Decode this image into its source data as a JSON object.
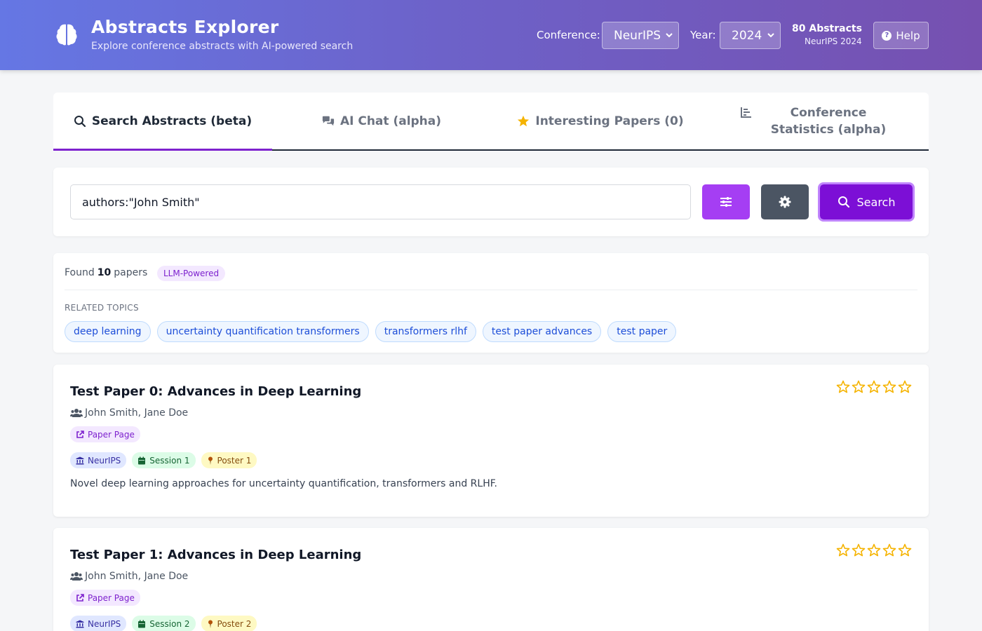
{
  "header": {
    "title": "Abstracts Explorer",
    "subtitle": "Explore conference abstracts with AI-powered search",
    "conference_label": "Conference:",
    "conference_value": "NeurIPS",
    "year_label": "Year:",
    "year_value": "2024",
    "count_main": "80 Abstracts",
    "count_sub": "NeurIPS 2024",
    "help_label": "Help"
  },
  "tabs": [
    {
      "label": "Search Abstracts (beta)",
      "icon": "search-icon",
      "active": true
    },
    {
      "label": "AI Chat (alpha)",
      "icon": "chat-icon",
      "active": false
    },
    {
      "label": "Interesting Papers (0)",
      "icon": "star-icon",
      "active": false
    },
    {
      "label": "Conference Statistics (alpha)",
      "icon": "chart-icon",
      "active": false
    }
  ],
  "search": {
    "query": "authors:\"John Smith\"",
    "filter_icon": "sliders-icon",
    "settings_icon": "gear-icon",
    "button_label": "Search"
  },
  "results": {
    "found_prefix": "Found",
    "found_count": "10",
    "found_suffix": "papers",
    "badge": "LLM-Powered",
    "related_label": "RELATED TOPICS",
    "topics": [
      "deep learning",
      "uncertainty quantification transformers",
      "transformers rlhf",
      "test paper advances",
      "test paper"
    ]
  },
  "papers": [
    {
      "title": "Test Paper 0: Advances in Deep Learning",
      "authors": "John Smith, Jane Doe",
      "page_label": "Paper Page",
      "conference": "NeurIPS",
      "session": "Session 1",
      "poster": "Poster 1",
      "abstract": "Novel deep learning approaches for uncertainty quantification, transformers and RLHF.",
      "rating": 0
    },
    {
      "title": "Test Paper 1: Advances in Deep Learning",
      "authors": "John Smith, Jane Doe",
      "page_label": "Paper Page",
      "conference": "NeurIPS",
      "session": "Session 2",
      "poster": "Poster 2",
      "rating": 0
    }
  ],
  "colors": {
    "accent": "#7c0fd6",
    "filter_button": "#a53ef3",
    "settings_button": "#4b5563",
    "star": "#f5b300"
  }
}
